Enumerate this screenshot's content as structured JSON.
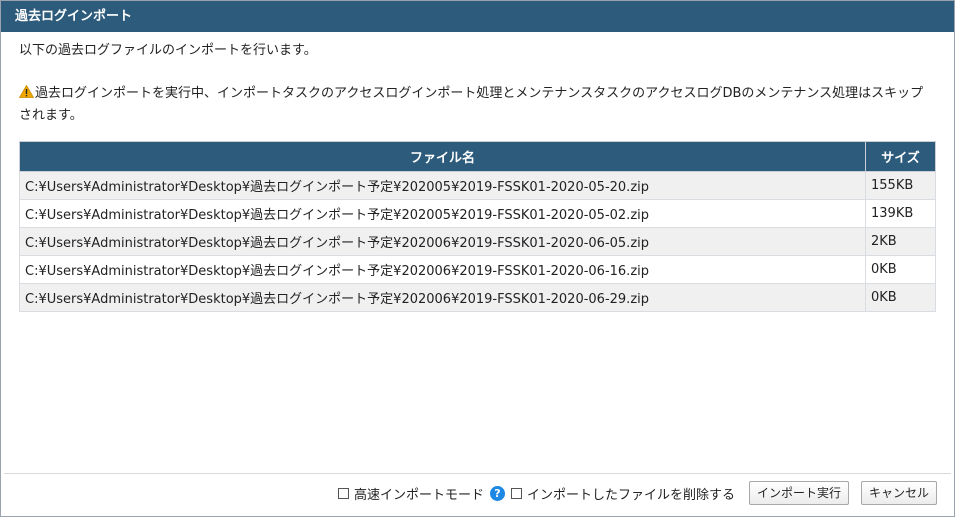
{
  "dialog": {
    "title": "過去ログインポート",
    "intro": "以下の過去ログファイルのインポートを行います。",
    "warning_text": "過去ログインポートを実行中、インポートタスクのアクセスログインポート処理とメンテナンスタスクのアクセスログDBのメンテナンス処理はスキップされます。",
    "warning_icon": "warning-icon",
    "accent_color": "#2d5b7c"
  },
  "table": {
    "headers": {
      "name": "ファイル名",
      "size": "サイズ"
    },
    "rows": [
      {
        "name": "C:¥Users¥Administrator¥Desktop¥過去ログインポート予定¥202005¥2019-FSSK01-2020-05-20.zip",
        "size": "155KB"
      },
      {
        "name": "C:¥Users¥Administrator¥Desktop¥過去ログインポート予定¥202005¥2019-FSSK01-2020-05-02.zip",
        "size": "139KB"
      },
      {
        "name": "C:¥Users¥Administrator¥Desktop¥過去ログインポート予定¥202006¥2019-FSSK01-2020-06-05.zip",
        "size": "2KB"
      },
      {
        "name": "C:¥Users¥Administrator¥Desktop¥過去ログインポート予定¥202006¥2019-FSSK01-2020-06-16.zip",
        "size": "0KB"
      },
      {
        "name": "C:¥Users¥Administrator¥Desktop¥過去ログインポート予定¥202006¥2019-FSSK01-2020-06-29.zip",
        "size": "0KB"
      }
    ]
  },
  "footer": {
    "fast_mode_label": "高速インポートモード",
    "fast_mode_checked": false,
    "help_glyph": "?",
    "delete_label": "インポートしたファイルを削除する",
    "delete_checked": false,
    "import_button": "インポート実行",
    "cancel_button": "キャンセル"
  }
}
